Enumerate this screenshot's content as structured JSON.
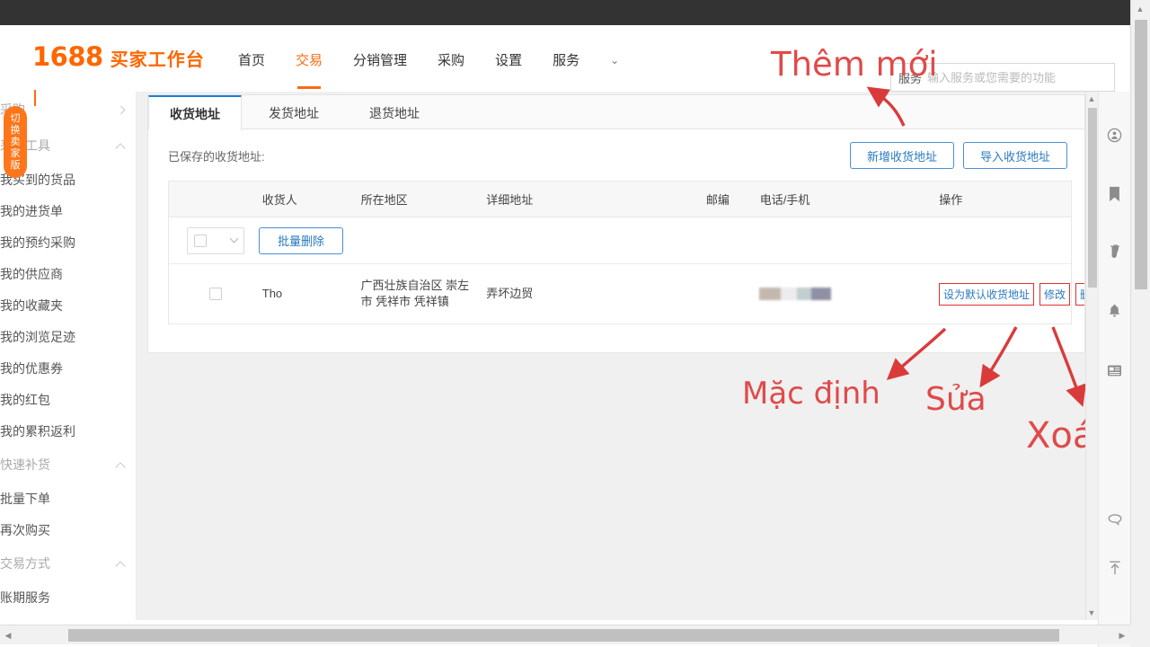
{
  "header": {
    "logo_number": "1688",
    "logo_text": "买家工作台",
    "nav": [
      {
        "label": "首页",
        "active": false
      },
      {
        "label": "交易",
        "active": true
      },
      {
        "label": "分销管理",
        "active": false
      },
      {
        "label": "采购",
        "active": false
      },
      {
        "label": "设置",
        "active": false
      },
      {
        "label": "服务",
        "active": false
      }
    ],
    "nav_more_icon": "chevron-down-icon",
    "search": {
      "scope_label": "服务",
      "placeholder": "输入服务或您需要的功能",
      "value": ""
    }
  },
  "sidebar": {
    "seller_badge": [
      "切",
      "换",
      "卖",
      "家",
      "版"
    ],
    "items": [
      {
        "type": "group",
        "label": "采购",
        "arrow": "chevron-right-icon"
      },
      {
        "type": "group",
        "label": "采购工具",
        "arrow": "chevron-up-icon"
      },
      {
        "type": "link",
        "label": "我买到的货品"
      },
      {
        "type": "link",
        "label": "我的进货单"
      },
      {
        "type": "link",
        "label": "我的预约采购"
      },
      {
        "type": "link",
        "label": "我的供应商"
      },
      {
        "type": "link",
        "label": "我的收藏夹"
      },
      {
        "type": "link",
        "label": "我的浏览足迹"
      },
      {
        "type": "link",
        "label": "我的优惠券"
      },
      {
        "type": "link",
        "label": "我的红包"
      },
      {
        "type": "link",
        "label": "我的累积返利"
      },
      {
        "type": "group",
        "label": "快速补货",
        "arrow": "chevron-up-icon"
      },
      {
        "type": "link",
        "label": "批量下单"
      },
      {
        "type": "link",
        "label": "再次购买"
      },
      {
        "type": "group",
        "label": "交易方式",
        "arrow": "chevron-up-icon"
      },
      {
        "type": "link",
        "label": "账期服务"
      }
    ]
  },
  "main": {
    "tabs": [
      {
        "label": "收货地址",
        "active": true
      },
      {
        "label": "发货地址",
        "active": false
      },
      {
        "label": "退货地址",
        "active": false
      }
    ],
    "saved_label": "已保存的收货地址:",
    "add_button": "新增收货地址",
    "import_button": "导入收货地址",
    "table": {
      "columns": [
        "",
        "收货人",
        "所在地区",
        "详细地址",
        "邮编",
        "电话/手机",
        "操作"
      ],
      "toolbar": {
        "select_all_checkbox": "unchecked-checkbox-icon",
        "select_all_caret": "chevron-down-icon",
        "batch_delete": "批量删除"
      },
      "rows": [
        {
          "checkbox": "unchecked-checkbox-icon",
          "receiver": "Tho",
          "region": "广西壮族自治区 崇左市 凭祥市 凭祥镇",
          "detail": "弄坏边贸",
          "zip": "",
          "phone_masked": "redacted-phone-number",
          "actions": [
            {
              "label": "设为默认收货地址",
              "annotated": true
            },
            {
              "label": "修改",
              "annotated": true
            },
            {
              "label": "删除",
              "annotated": true
            }
          ]
        }
      ]
    }
  },
  "annotations": {
    "color": "#e04a4a",
    "items": [
      {
        "text": "Thêm mới",
        "target": "新增收货地址"
      },
      {
        "text": "Mặc định",
        "target": "设为默认收货地址"
      },
      {
        "text": "Sửa",
        "target": "修改"
      },
      {
        "text": "Xoá",
        "target": "删除"
      }
    ]
  },
  "right_rail": {
    "icons": [
      "account-icon",
      "bookmark-icon",
      "footprint-icon",
      "bell-icon",
      "news-icon",
      "message-icon",
      "back-to-top-icon"
    ]
  },
  "scrollbars": {
    "horizontal_left_arrow": "◀",
    "horizontal_right_arrow": "▶",
    "vertical_up_arrow": "▲",
    "vertical_down_arrow": "▼"
  }
}
